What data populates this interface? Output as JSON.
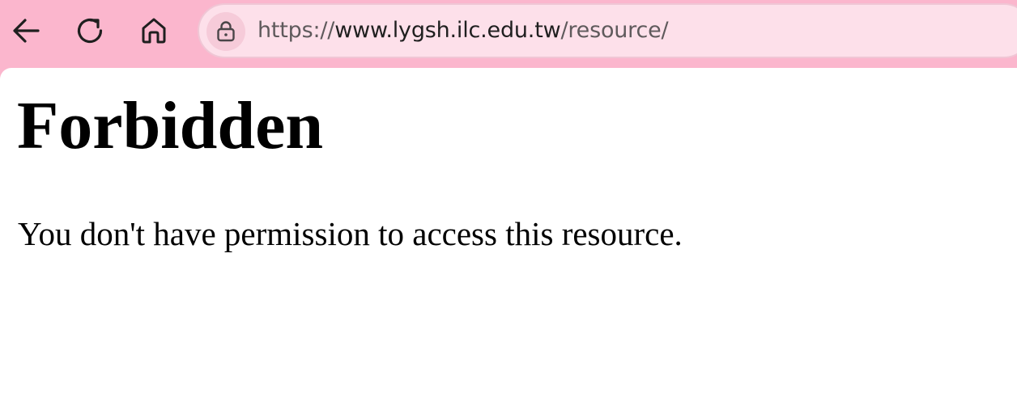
{
  "browser": {
    "url_scheme": "https://",
    "url_host": "www.lygsh.ilc.edu.tw",
    "url_path": "/resource/",
    "icons": [
      "back-arrow-icon",
      "reload-icon",
      "home-icon",
      "lock-icon"
    ],
    "theme_color": "#fbb6cd",
    "omnibox_color": "#fde0ea"
  },
  "page": {
    "title": "Forbidden",
    "message": "You don't have permission to access this resource."
  }
}
